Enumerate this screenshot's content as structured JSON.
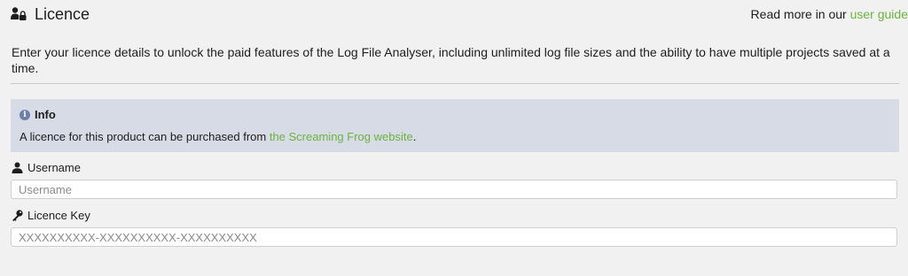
{
  "header": {
    "title": "Licence",
    "guide_prefix": "Read more in our ",
    "guide_link": "user guide"
  },
  "intro": "Enter your licence details to unlock the paid features of the Log File Analyser, including unlimited log file sizes and the ability to have multiple projects saved at a time.",
  "info": {
    "heading": "Info",
    "text_prefix": "A licence for this product can be purchased from ",
    "link": "the Screaming Frog website",
    "text_suffix": "."
  },
  "username": {
    "label": "Username",
    "placeholder": "Username",
    "value": ""
  },
  "licence_key": {
    "label": "Licence Key",
    "placeholder": "XXXXXXXXXX-XXXXXXXXXX-XXXXXXXXXX",
    "value": ""
  },
  "icons": {
    "header": "user-lock-icon",
    "info": "info-icon",
    "username": "user-icon",
    "licence_key": "key-icon"
  },
  "colors": {
    "link": "#6cb33f",
    "info_background": "#d7dbe6",
    "page_background": "#f1f1f1"
  }
}
